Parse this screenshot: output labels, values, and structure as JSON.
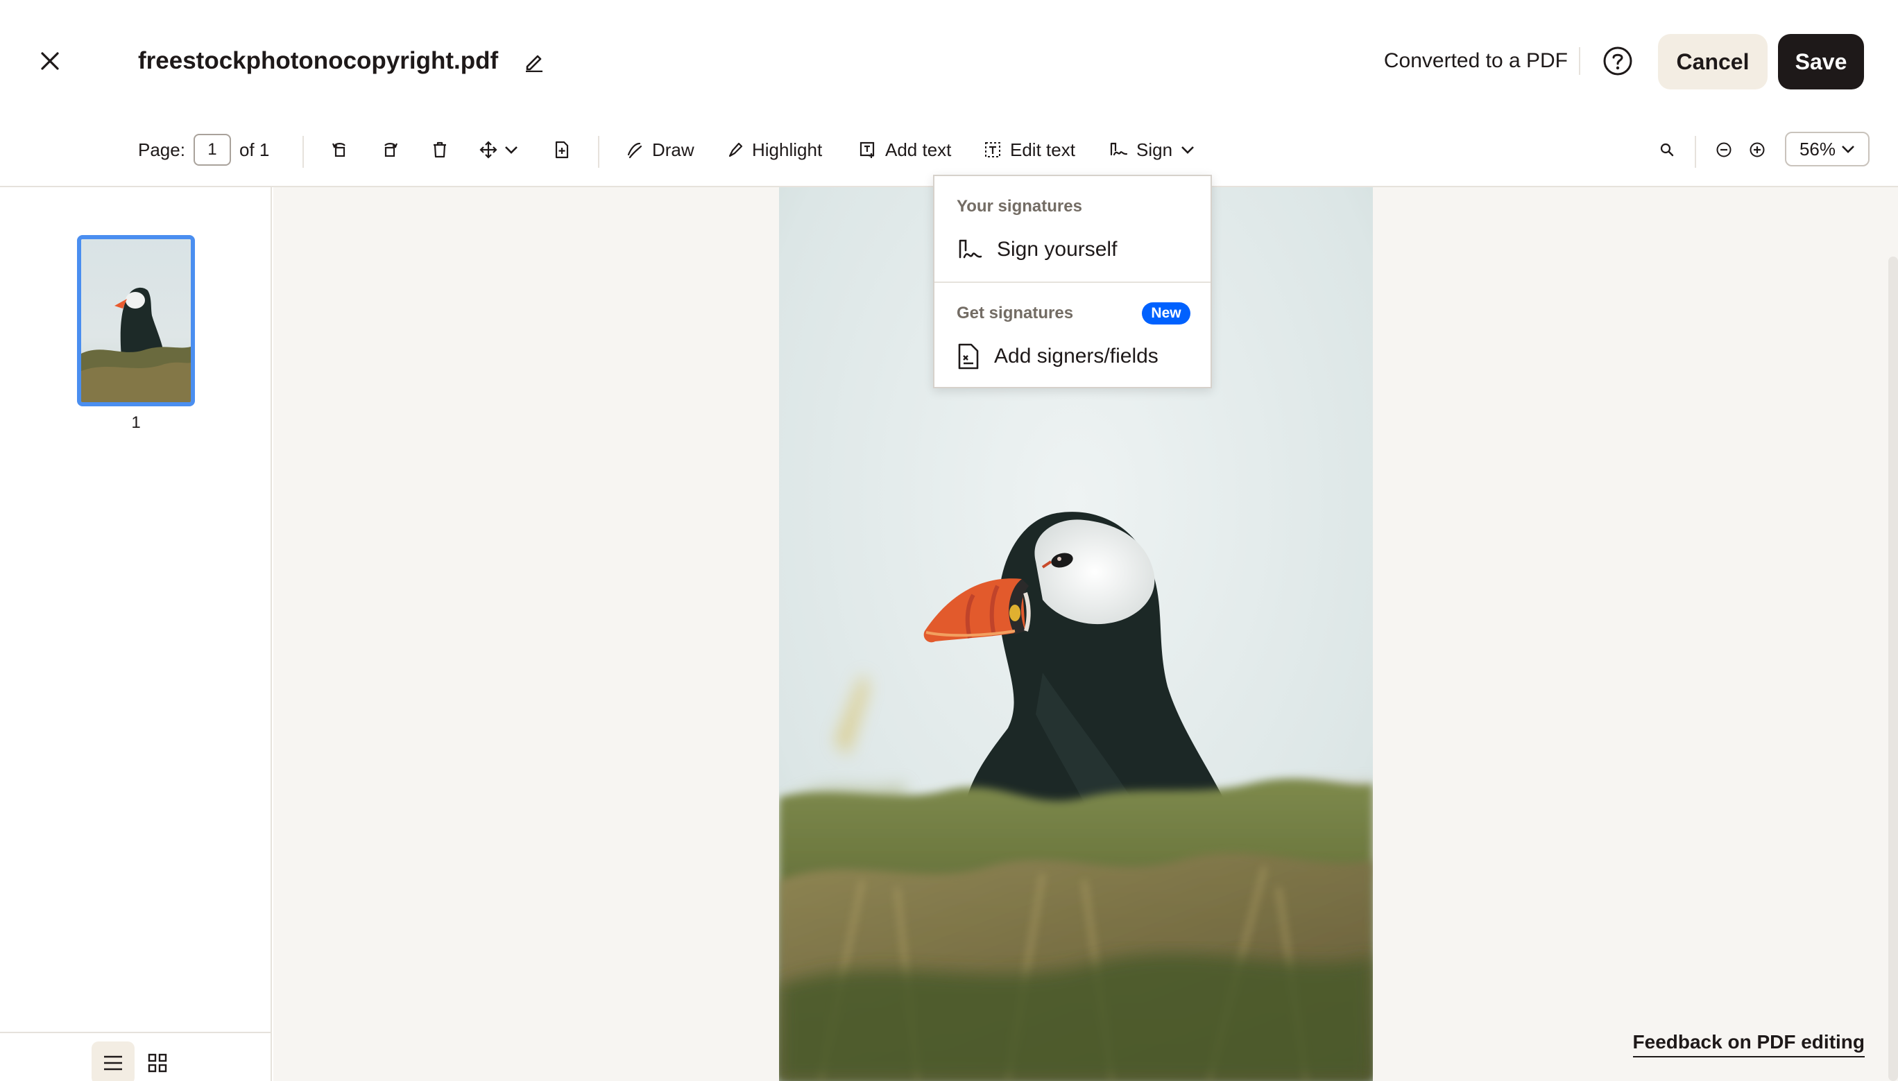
{
  "header": {
    "filename": "freestockphotonocopyright.pdf",
    "status": "Converted to a PDF",
    "cancel_label": "Cancel",
    "save_label": "Save"
  },
  "toolbar": {
    "page_label": "Page:",
    "page_value": "1",
    "page_of": "of 1",
    "draw_label": "Draw",
    "highlight_label": "Highlight",
    "add_text_label": "Add text",
    "edit_text_label": "Edit text",
    "sign_label": "Sign",
    "zoom_value": "56%"
  },
  "sidebar": {
    "thumbnails": [
      {
        "page_number": "1"
      }
    ]
  },
  "sign_menu": {
    "your_signatures_heading": "Your signatures",
    "sign_yourself_label": "Sign yourself",
    "get_signatures_heading": "Get signatures",
    "new_badge": "New",
    "add_signers_label": "Add signers/fields"
  },
  "footer": {
    "feedback_label": "Feedback on PDF editing"
  },
  "colors": {
    "accent_blue": "#0061fe",
    "thumb_border": "#4a8ef0",
    "cancel_bg": "#f3ede3",
    "save_bg": "#1e1919",
    "canvas_bg": "#f7f5f2"
  },
  "icons": [
    "close-icon",
    "pencil-icon",
    "help-icon",
    "rotate-left-icon",
    "rotate-right-icon",
    "trash-icon",
    "move-icon",
    "chevron-down-icon",
    "insert-page-icon",
    "draw-icon",
    "highlight-icon",
    "add-text-icon",
    "edit-text-icon",
    "sign-icon",
    "search-icon",
    "zoom-out-icon",
    "zoom-in-icon",
    "list-view-icon",
    "grid-view-icon",
    "document-signers-icon"
  ]
}
